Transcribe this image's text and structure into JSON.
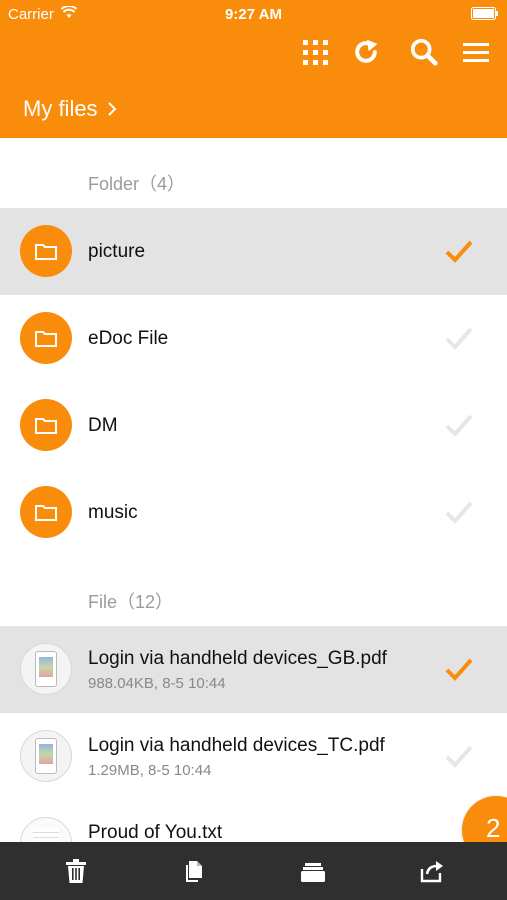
{
  "status_bar": {
    "carrier": "Carrier",
    "time": "9:27 AM"
  },
  "header": {
    "breadcrumb": "My files",
    "icons": [
      "grid-icon",
      "refresh-icon",
      "search-icon",
      "menu-icon"
    ]
  },
  "folders_section": {
    "label": "Folder（4）"
  },
  "folders": [
    {
      "name": "picture",
      "selected": true
    },
    {
      "name": "eDoc File",
      "selected": false
    },
    {
      "name": "DM",
      "selected": false
    },
    {
      "name": "music",
      "selected": false
    }
  ],
  "files_section": {
    "label": "File（12）"
  },
  "files": [
    {
      "name": "Login via handheld devices_GB.pdf",
      "meta": "988.04KB, 8-5 10:44",
      "selected": true
    },
    {
      "name": "Login via handheld devices_TC.pdf",
      "meta": "1.29MB, 8-5 10:44",
      "selected": false
    },
    {
      "name": "Proud of You.txt",
      "meta": "",
      "selected": false
    }
  ],
  "selection_badge": {
    "count": "2"
  },
  "bottom_bar": {
    "icons": [
      "trash-icon",
      "copy-icon",
      "move-icon",
      "share-icon"
    ]
  },
  "colors": {
    "accent": "#f98d0b",
    "selected_row": "#e3e3e3",
    "bottom_bar": "#2f2f2f",
    "check_inactive": "#e6e6e6"
  }
}
